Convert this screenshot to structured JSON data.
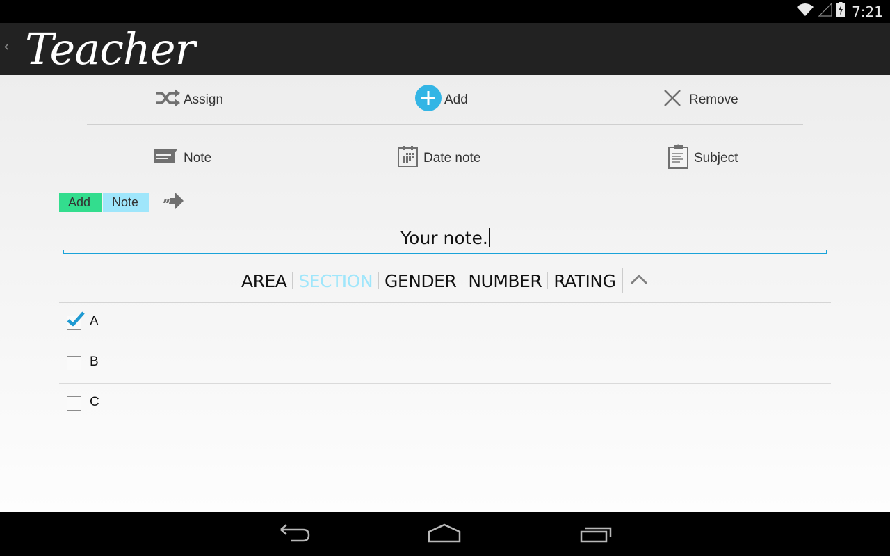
{
  "status_bar": {
    "time": "7:21",
    "icons": [
      "wifi-icon",
      "cell-signal-icon",
      "battery-charging-icon"
    ]
  },
  "action_bar": {
    "back_icon": "chevron-left-icon",
    "title": "Teacher"
  },
  "actions_row1": [
    {
      "label": "Assign",
      "icon": "shuffle-icon"
    },
    {
      "label": "Add",
      "icon": "plus-circle-icon"
    },
    {
      "label": "Remove",
      "icon": "close-icon"
    }
  ],
  "actions_row2": [
    {
      "label": "Note",
      "icon": "note-icon"
    },
    {
      "label": "Date note",
      "icon": "calendar-icon"
    },
    {
      "label": "Subject",
      "icon": "clipboard-icon"
    }
  ],
  "tags": {
    "mode": "Add",
    "type": "Note",
    "next_icon": "arrow-right-icon"
  },
  "note_input": {
    "value": "Your note."
  },
  "filters": {
    "tabs": [
      "AREA",
      "SECTION",
      "GENDER",
      "NUMBER",
      "RATING"
    ],
    "active": "SECTION",
    "collapse_icon": "chevron-up-icon"
  },
  "list": {
    "items": [
      {
        "label": "A",
        "checked": true
      },
      {
        "label": "B",
        "checked": false
      },
      {
        "label": "C",
        "checked": false
      }
    ]
  },
  "colors": {
    "accent": "#33b5e5",
    "tag_add": "#33dd8e",
    "tag_note": "#9fe6fb",
    "input_underline": "#1aa3d9"
  },
  "nav_bar": {
    "buttons": [
      "back-icon",
      "home-icon",
      "recent-apps-icon"
    ]
  }
}
